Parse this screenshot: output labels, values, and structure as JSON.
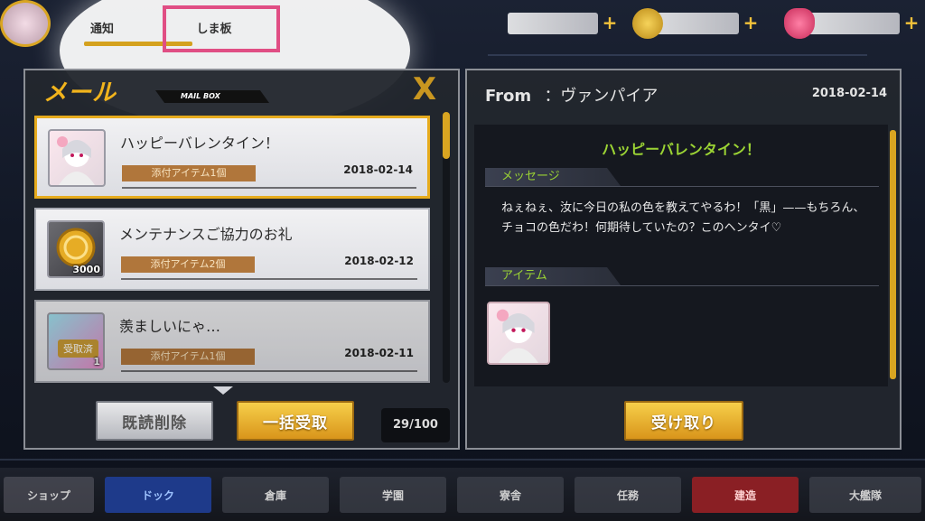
{
  "tabs": {
    "tab1": "通知",
    "tab2": "しま板"
  },
  "mail": {
    "title": "メール",
    "subtitle": "MAIL BOX",
    "close_label": "X",
    "items": [
      {
        "subject": "ハッピーバレンタイン！",
        "attachment": "添付アイテム1個",
        "date": "2018-02-14",
        "count": "",
        "received": ""
      },
      {
        "subject": "メンテナンスご協力のお礼",
        "attachment": "添付アイテム2個",
        "date": "2018-02-12",
        "count": "3000",
        "received": ""
      },
      {
        "subject": "羨ましいにゃ…",
        "attachment": "添付アイテム1個",
        "date": "2018-02-11",
        "count": "1",
        "received": "受取済"
      }
    ],
    "delete_read_label": "既読削除",
    "claim_all_label": "一括受取",
    "count": "29/100"
  },
  "detail": {
    "from_label": "From",
    "from_name": "：ヴァンパイア",
    "date": "2018-02-14",
    "subject": "ハッピーバレンタイン！",
    "message_label": "メッセージ",
    "message": "ねぇねぇ、汝に今日の私の色を教えてやるわ！「黒」——もちろん、チョコの色だわ！何期待していたの？このヘンタイ♡",
    "item_label": "アイテム",
    "claim_label": "受け取り"
  },
  "nav": {
    "shop": "ショップ",
    "dock": "ドック",
    "items": [
      "倉庫",
      "学園",
      "寮舎",
      "任務",
      "建造",
      "大艦隊"
    ]
  },
  "colors": {
    "accent": "#d9a521",
    "green": "#9bd334",
    "highlight": "#e04e84"
  }
}
